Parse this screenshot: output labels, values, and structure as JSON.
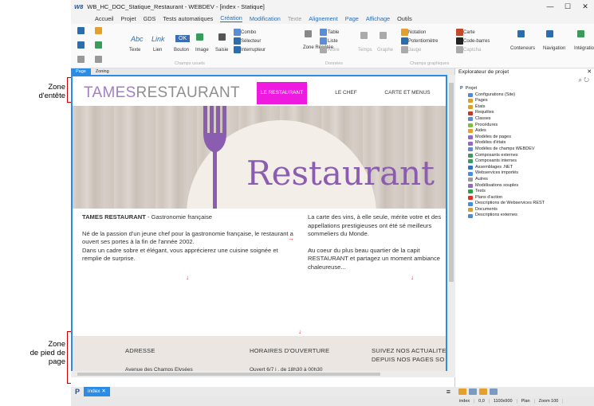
{
  "annotations": {
    "header_zone": "Zone\nd'entête",
    "footer_zone": "Zone\nde pied de\npage"
  },
  "window": {
    "logo": "W8",
    "title": "WB_HC_DOC_Statique_Restaurant - WEBDEV - [index - Statique]",
    "min": "—",
    "max": "☐",
    "close": "✕"
  },
  "menu_tabs": [
    "Accueil",
    "Projet",
    "GDS",
    "Tests automatiques",
    "Création",
    "Modification",
    "Texte",
    "Alignement",
    "Page",
    "Affichage",
    "Outils"
  ],
  "menu_active": "Création",
  "ribbon": {
    "groups": {
      "champs_usuels": "Champs usuels",
      "donnees": "Données",
      "champs_graphiques": "Champs graphiques"
    },
    "items": {
      "texte": "Texte",
      "lien": "Lien",
      "bouton": "Bouton",
      "image": "Image",
      "saisie": "Saisie",
      "abc": "Abc",
      "link": "Link",
      "ok": "OK",
      "combo": "Combo",
      "selecteur": "Sélecteur",
      "interrupteur": "Interrupteur",
      "zone_repetee": "Zone Répétée",
      "table": "Table",
      "liste": "Liste",
      "arbre": "Arbre",
      "temps": "Temps",
      "graphe": "Graphe",
      "notation": "Notation",
      "potentiometre": "Potentiomètre",
      "jauge": "Jauge",
      "carte": "Carte",
      "code_barres": "Code-barres",
      "captcha": "Captcha",
      "conteneurs": "Conteneurs",
      "navigation": "Navigation",
      "integration": "Intégration"
    }
  },
  "editor": {
    "tabs": [
      "Page",
      "Zoning"
    ],
    "active_tab": "Page"
  },
  "site": {
    "brand_a": "TAMES",
    "brand_b": "RESTAURANT",
    "nav": [
      "LE RESTAURANT",
      "LE CHEF",
      "CARTE ET MENUS"
    ],
    "hero_word": "Restaurant",
    "col1_title": "TAMES RESTAURANT",
    "col1_sub": " - Gastronomie française",
    "col1_p1": "Né de la passion d'un jeune chef pour la gastronomie française, le restaurant a ouvert ses portes à la fin de l'année 2002.",
    "col1_p2": "Dans un cadre sobre et élégant, vous apprécierez une cuisine soignée et remplie de surprise.",
    "col2_p1": "La carte des vins, à elle seule, mérite votre et des appellations prestigieuses ont été sé meilleurs sommeliers du Monde.",
    "col2_p2": "Au coeur du plus beau quartier de la capit RESTAURANT et partagez un moment ambiance chaleureuse...",
    "footer": {
      "h1": "ADRESSE",
      "t1": "Avenue des Champs Elysées",
      "h2": "HORAIRES D'OUVERTURE",
      "t2": "Ouvert 6/7 j , de 18h30 à 00h30",
      "h3": "SUIVEZ NOS ACTUALITE",
      "h3b": "DEPUIS NOS PAGES SO"
    }
  },
  "bottom": {
    "project_icon": "P",
    "doc_tab": "index",
    "close": "✕"
  },
  "explorer": {
    "title": "Explorateur de projet",
    "root": "Projet",
    "items": [
      "Configurations (Site)",
      "Pages",
      "États",
      "Requêtes",
      "Classes",
      "Procédures",
      "Aides",
      "Modèles de pages",
      "Modèles d'états",
      "Modèles de champs WEBDEV",
      "Composants externes",
      "Composants internes",
      "Assemblages .NET",
      "Webservices importés",
      "Autres",
      "Modélisations souples",
      "Tests",
      "Plans d'action",
      "Descriptions de Webservices REST",
      "Documents",
      "Descriptions externes"
    ],
    "icon_colors": [
      "#4a8be0",
      "#d9a12c",
      "#d9a12c",
      "#c0392b",
      "#5b8dd6",
      "#7cbf3a",
      "#e8a02c",
      "#8e6cc0",
      "#8e6cc0",
      "#5b8dd6",
      "#3b9b5a",
      "#3b9b5a",
      "#3471c6",
      "#4a8be0",
      "#999999",
      "#8e6cc0",
      "#2e9e4f",
      "#e0302a",
      "#4a8be0",
      "#d9a12c",
      "#4a8be0"
    ]
  },
  "status": {
    "page": "index",
    "coords": "0,0",
    "size": "1100x900",
    "mode": "Plan",
    "zoom": "Zoom 100"
  }
}
